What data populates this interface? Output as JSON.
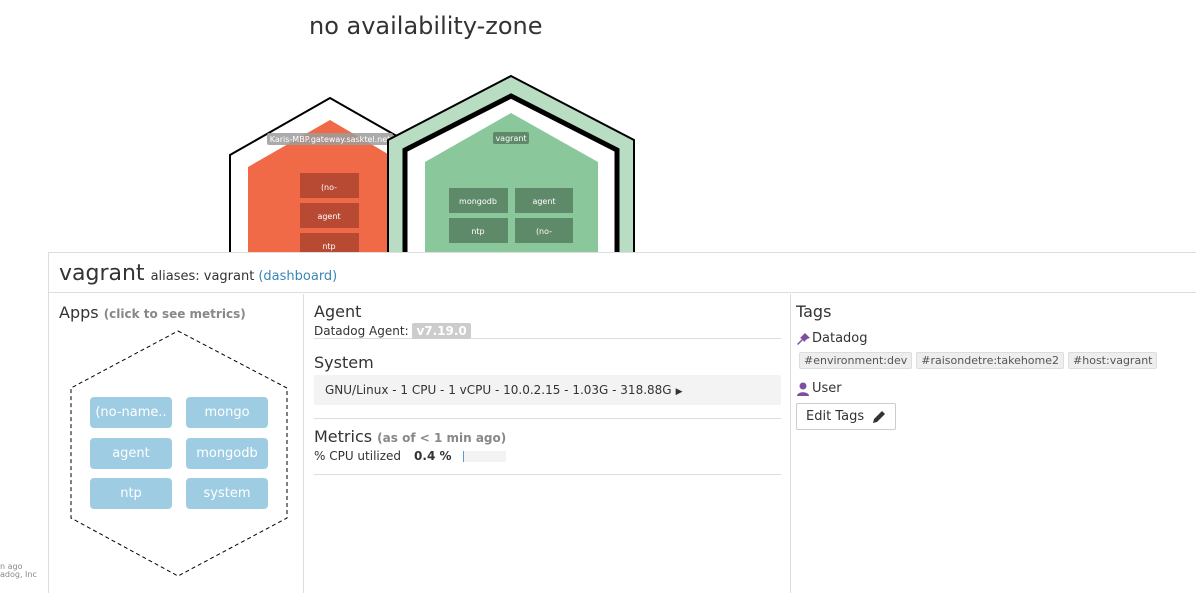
{
  "zone": {
    "title": "no availability-zone"
  },
  "map": {
    "hosts": [
      {
        "name": "Karis-MBP.gateway.sasktel.net",
        "apps": [
          "(no-",
          "agent",
          "ntp"
        ],
        "color": "#f06a48"
      },
      {
        "name": "vagrant",
        "apps": [
          "mongodb",
          "agent",
          "ntp",
          "(no-"
        ],
        "color": "#8ac79b"
      }
    ]
  },
  "header": {
    "host_name": "vagrant",
    "aliases": "aliases: vagrant",
    "dashboard_link": "(dashboard)"
  },
  "apps": {
    "title": "Apps",
    "hint": "(click to see metrics)",
    "items": [
      "(no-name..",
      "mongo",
      "agent",
      "mongodb",
      "ntp",
      "system"
    ]
  },
  "agent": {
    "title": "Agent",
    "label": "Datadog Agent:",
    "version": "v7.19.0"
  },
  "system": {
    "title": "System",
    "info": "GNU/Linux - 1 CPU - 1 vCPU - 10.0.2.15 - 1.03G - 318.88G"
  },
  "metrics": {
    "title": "Metrics",
    "hint": "(as of < 1 min ago)",
    "cpu_label": "% CPU utilized",
    "cpu_value": "0.4 %",
    "cpu_fraction": 0.004
  },
  "tags": {
    "title": "Tags",
    "groups": [
      {
        "name": "Datadog",
        "chips": [
          "#environment:dev",
          "#raisondetre:takehome2",
          "#host:vagrant"
        ]
      },
      {
        "name": "User",
        "chips": []
      }
    ],
    "edit_label": "Edit Tags"
  },
  "footer": {
    "line1": "n ago",
    "line2": "adog, Inc"
  },
  "colors": {
    "accent_link": "#3a87b6",
    "tag_icon": "#7e4f9e",
    "app_button": "#9ecce3"
  }
}
